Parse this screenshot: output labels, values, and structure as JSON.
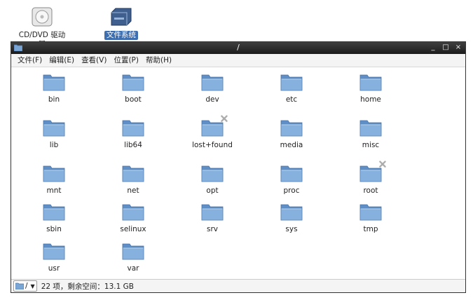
{
  "desktop": {
    "icons": [
      {
        "label": "CD/DVD 驱动器",
        "icon": "optical-drive-icon"
      },
      {
        "label": "文件系统",
        "icon": "filesystem-drive-icon"
      }
    ]
  },
  "window": {
    "title": "/",
    "controls": [
      "_",
      "□",
      "×"
    ]
  },
  "menubar": {
    "items": [
      "文件(F)",
      "编辑(E)",
      "查看(V)",
      "位置(P)",
      "帮助(H)"
    ]
  },
  "files": [
    {
      "name": "bin"
    },
    {
      "name": "boot"
    },
    {
      "name": "dev"
    },
    {
      "name": "etc"
    },
    {
      "name": "home"
    },
    {
      "name": "lib"
    },
    {
      "name": "lib64"
    },
    {
      "name": "lost+found",
      "emblem": "no-access-icon"
    },
    {
      "name": "media"
    },
    {
      "name": "misc"
    },
    {
      "name": "mnt"
    },
    {
      "name": "net"
    },
    {
      "name": "opt"
    },
    {
      "name": "proc"
    },
    {
      "name": "root",
      "emblem": "no-access-icon"
    },
    {
      "name": "sbin"
    },
    {
      "name": "selinux"
    },
    {
      "name": "srv"
    },
    {
      "name": "sys"
    },
    {
      "name": "tmp"
    },
    {
      "name": "usr"
    },
    {
      "name": "var"
    }
  ],
  "statusbar": {
    "path_label": "/",
    "info": "22 项，剩余空间：13.1 GB"
  },
  "colors": {
    "folder": "#7aa6d6",
    "folder_dark": "#5a86b8",
    "selection": "#3d6fb0",
    "titlebar": "#2a2a2a"
  }
}
